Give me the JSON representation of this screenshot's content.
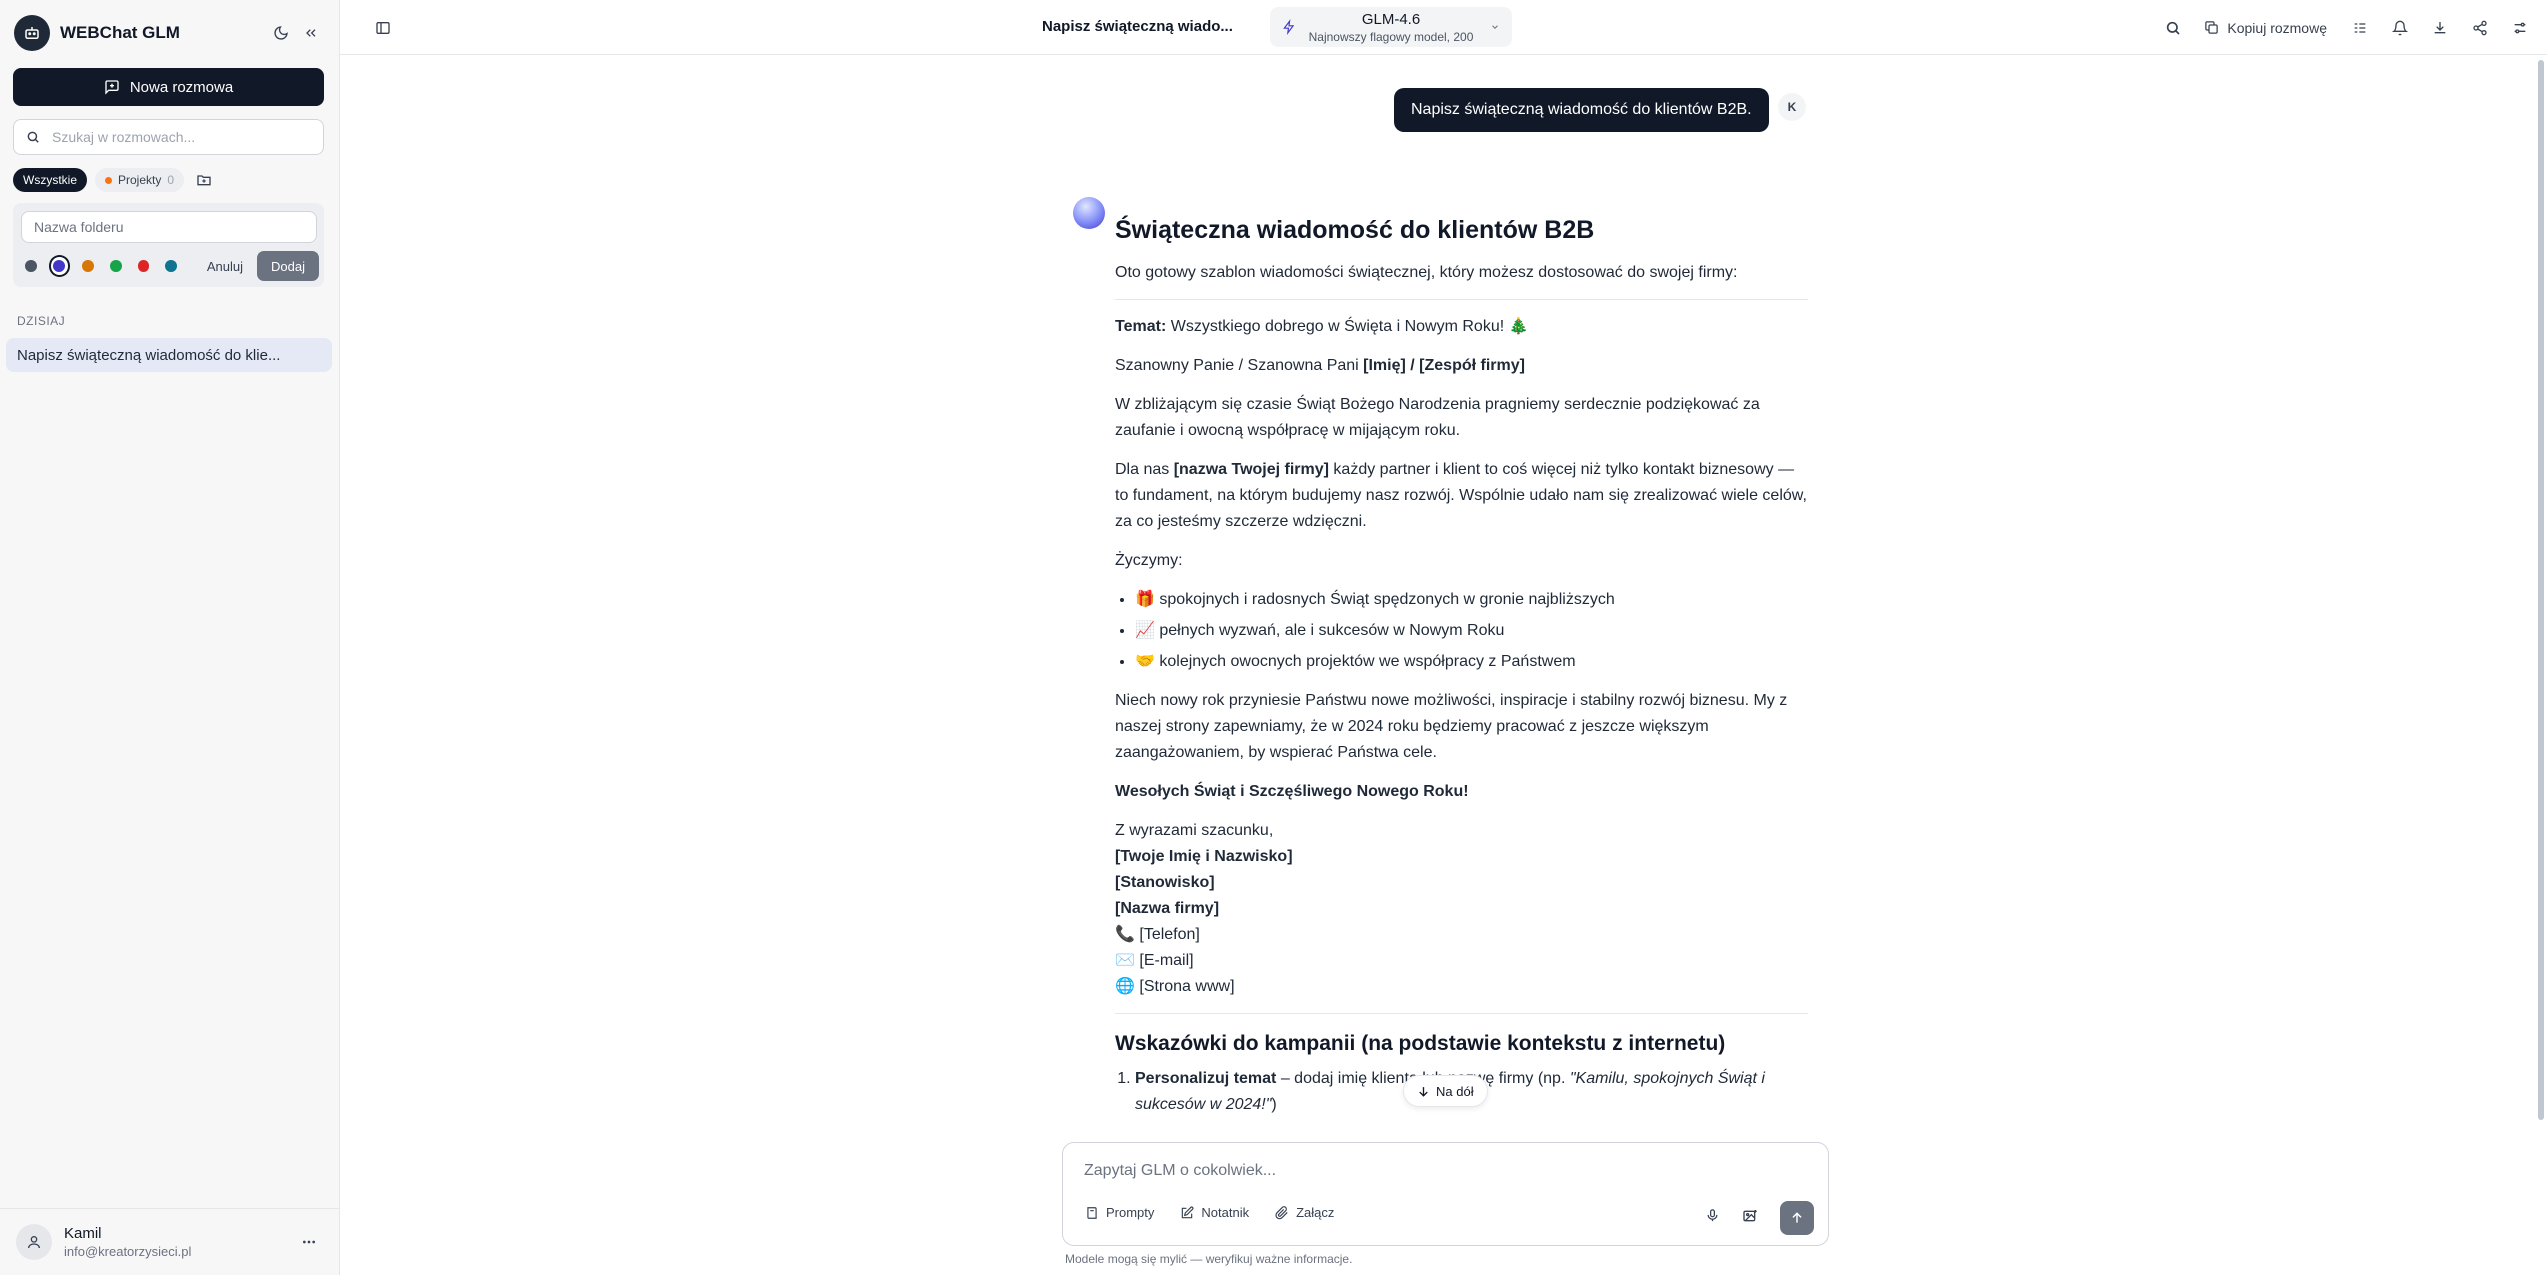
{
  "sidebar": {
    "app_name": "WEBChat GLM",
    "new_chat_label": "Nowa rozmowa",
    "search_placeholder": "Szukaj w rozmowach...",
    "filter_all": "Wszystkie",
    "filter_projects": "Projekty",
    "filter_projects_count": "0",
    "folder_placeholder": "Nazwa folderu",
    "folder_colors": [
      "#4b5563",
      "#4338ca",
      "#d97706",
      "#16a34a",
      "#dc2626",
      "#0e7490"
    ],
    "cancel_label": "Anuluj",
    "add_label": "Dodaj",
    "section_today": "DZISIAJ",
    "conversations": [
      "Napisz świąteczną wiadomość do klie..."
    ],
    "user": {
      "name": "Kamil",
      "email": "info@kreatorzysieci.pl"
    }
  },
  "topbar": {
    "chat_title": "Napisz świąteczną wiado...",
    "model_name": "GLM-4.6",
    "model_sub": "Najnowszy flagowy model, 200",
    "copy_label": "Kopiuj rozmowę"
  },
  "chat": {
    "user_message": "Napisz świąteczną wiadomość do klientów B2B.",
    "user_initial": "K",
    "answer": {
      "title": "Świąteczna wiadomość do klientów B2B",
      "intro": "Oto gotowy szablon wiadomości świątecznej, który możesz dostosować do swojej firmy:",
      "subject_label": "Temat:",
      "subject_text": " Wszystkiego dobrego w Święta i Nowym Roku! 🎄",
      "greeting": "Szanowny Panie / Szanowna Pani ",
      "greeting_bold": "[Imię] / [Zespół firmy]",
      "para1": "W zbliżającym się czasie Świąt Bożego Narodzenia pragniemy serdecznie podziękować za zaufanie i owocną współpracę w mijającym roku.",
      "para2_start": "Dla nas ",
      "para2_bold": "[nazwa Twojej firmy]",
      "para2_end": " każdy partner i klient to coś więcej niż tylko kontakt biznesowy — to fundament, na którym budujemy nasz rozwój. Wspólnie udało nam się zrealizować wiele celów, za co jesteśmy szczerze wdzięczni.",
      "wishes_label": "Życzymy:",
      "wishes": [
        "🎁 spokojnych i radosnych Świąt spędzonych w gronie najbliższych",
        "📈 pełnych wyzwań, ale i sukcesów w Nowym Roku",
        "🤝 kolejnych owocnych projektów we współpracy z Państwem"
      ],
      "para3": "Niech nowy rok przyniesie Państwu nowe możliwości, inspiracje i stabilny rozwój biznesu. My z naszej strony zapewniamy, że w 2024 roku będziemy pracować z jeszcze większym zaangażowaniem, by wspierać Państwa cele.",
      "closing": "Wesołych Świąt i Szczęśliwego Nowego Roku!",
      "regards": "Z wyrazami szacunku,",
      "sig_name": "[Twoje Imię i Nazwisko]",
      "sig_position": "[Stanowisko]",
      "sig_company": "[Nazwa firmy]",
      "sig_phone": "📞 [Telefon]",
      "sig_email": "✉️ [E-mail]",
      "sig_www": "🌐 [Strona www]",
      "tips_title": "Wskazówki do kampanii (na podstawie kontekstu z internetu)",
      "tip1_bold": "Personalizuj temat",
      "tip1_text": " – dodaj imię klienta lub nazwę firmy (np. ",
      "tip1_italic": "\"Kamilu, spokojnych Świąt i sukcesów w 2024!\"",
      "tip1_end": ")"
    },
    "scroll_down_label": "Na dół"
  },
  "composer": {
    "placeholder": "Zapytaj GLM o cokolwiek...",
    "prompts_label": "Prompty",
    "notebook_label": "Notatnik",
    "attach_label": "Załącz",
    "disclaimer": "Modele mogą się mylić — weryfikuj ważne informacje."
  },
  "colors": {
    "dark": "#111827",
    "accent": "#4338ca",
    "muted": "#6b7280"
  }
}
